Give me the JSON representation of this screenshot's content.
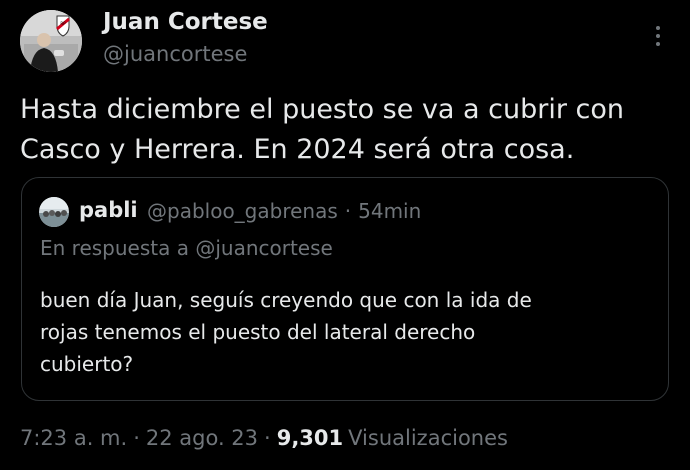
{
  "author": {
    "display_name": "Juan Cortese",
    "handle": "@juancortese",
    "avatar_icon": "profile-photo-icon"
  },
  "tweet": {
    "text_lines": [
      "Hasta diciembre el puesto se va a cubrir con",
      "Casco y Herrera. En 2024 será otra cosa."
    ]
  },
  "quote": {
    "display_name": "pabli",
    "handle": "@pabloo_gabrenas",
    "separator": "·",
    "time_ago": "54min",
    "reply_context": "En respuesta a @juancortese",
    "text_lines": [
      "buen día Juan, seguís creyendo que con la ida de",
      "rojas tenemos el puesto del lateral derecho",
      "cubierto?"
    ]
  },
  "footer": {
    "time": "7:23 a. m.",
    "separator": "·",
    "date": "22 ago. 23",
    "views_count": "9,301",
    "views_label": "Visualizaciones"
  },
  "colors": {
    "background": "#000000",
    "primary_text": "#e7e9ea",
    "secondary_text": "#71767b",
    "border": "#2f3336"
  }
}
